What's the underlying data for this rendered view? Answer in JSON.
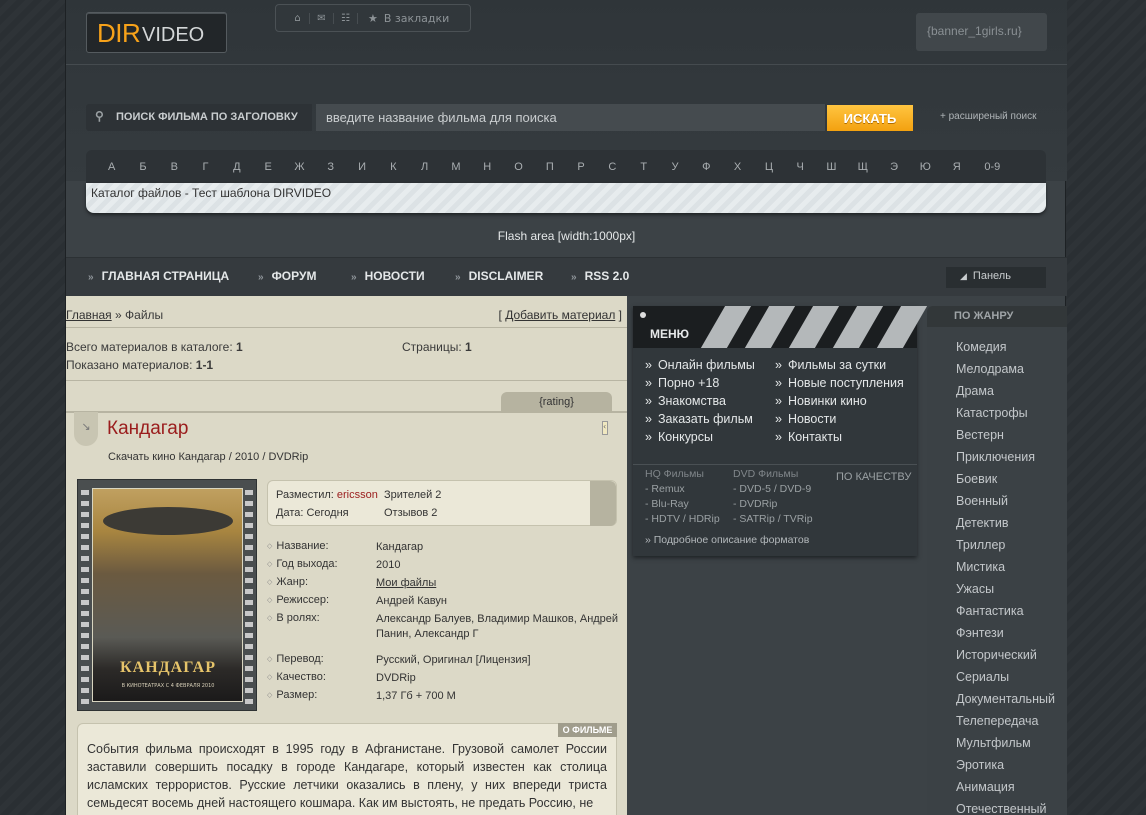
{
  "logo": {
    "part1": "DIR",
    "part2": "VIDEO"
  },
  "topnav": {
    "icons": [
      "home-icon",
      "mail-icon",
      "sitemap-icon"
    ],
    "bookmark": "В закладки"
  },
  "banner": "{banner_1girls.ru}",
  "search": {
    "label": "ПОИСК ФИЛЬМА ПО ЗАГОЛОВКУ",
    "placeholder": "введите название фильма для поиска",
    "button": "ИСКАТЬ",
    "advanced": "+ расширеный поиск"
  },
  "alphabet": [
    "А",
    "Б",
    "В",
    "Г",
    "Д",
    "Е",
    "Ж",
    "З",
    "И",
    "К",
    "Л",
    "М",
    "Н",
    "О",
    "П",
    "Р",
    "С",
    "Т",
    "У",
    "Ф",
    "Х",
    "Ц",
    "Ч",
    "Ш",
    "Щ",
    "Э",
    "Ю",
    "Я",
    "0-9"
  ],
  "breadcrumb_bar": "Каталог файлов - Тест шаблона DIRVIDEO",
  "flash": "Flash area [width:1000px]",
  "mainnav": {
    "items": [
      "ГЛАВНАЯ СТРАНИЦА",
      "ФОРУМ",
      "НОВОСТИ",
      "DISCLAIMER",
      "RSS 2.0"
    ],
    "panel": "Панель"
  },
  "content": {
    "breadcrumb": {
      "home": "Главная",
      "sep": " » ",
      "current": "Файлы"
    },
    "add": {
      "open": "[ ",
      "label": "Добавить материал",
      "close": " ]"
    },
    "total_label": "Всего материалов в каталоге: ",
    "total": "1",
    "shown_label": "Показано материалов: ",
    "shown": "1-1",
    "pages_label": "Страницы: ",
    "pages": "1",
    "rating_tab": "{rating}",
    "movie_title": "Кандагар",
    "subtitle": "Скачать кино Кандагар / 2010 / DVDRip",
    "poster": {
      "title": "КАНДАГАР",
      "date": "В КИНОТЕАТРАХ С 4 ФЕВРАЛЯ 2010"
    },
    "info": {
      "posted_label": "Разместил: ",
      "posted_by": "ericsson",
      "viewers": "Зрителей 2",
      "date": "Дата: Сегодня",
      "reviews": "Отзывов 2"
    },
    "details": [
      {
        "k": "Название:",
        "v": "Кандагар"
      },
      {
        "k": "Год выхода:",
        "v": "2010"
      },
      {
        "k": "Жанр:",
        "v": "Мои файлы"
      },
      {
        "k": "Режиссер:",
        "v": "Андрей Кавун"
      },
      {
        "k": "В ролях:",
        "v": "Александр Балуев, Владимир Машков, Андрей Панин, Александр Г"
      },
      {
        "k": "Перевод:",
        "v": "Русский, Оригинал [Лицензия]"
      },
      {
        "k": "Качество:",
        "v": "DVDRip"
      },
      {
        "k": "Размер:",
        "v": "1,37 Гб + 700 М"
      }
    ],
    "about_header": "О ФИЛЬМЕ",
    "about_text": "События фильма происходят в 1995 году в Афганистане. Грузовой самолет России заставили совершить посадку в городе Кандагаре, который известен как столица исламских террористов. Русские летчики оказались в плену, у них впереди триста семьдесят восемь дней настоящего кошмара. Как им выстоять, не предать Россию, не"
  },
  "menu": {
    "title": "МЕНЮ",
    "col1": [
      "Онлайн фильмы",
      "Порно +18",
      "Знакомства",
      "Заказать фильм",
      "Конкурсы"
    ],
    "col2": [
      "Фильмы за сутки",
      "Новые поступления",
      "Новинки кино",
      "Новости",
      "Контакты"
    ],
    "quality_title": "ПО КАЧЕСТВУ",
    "hq_title": "HQ Фильмы",
    "hq": [
      "- Remux",
      "- Blu-Ray",
      "- HDTV / HDRip"
    ],
    "dvd_title": "DVD Фильмы",
    "dvd": [
      "- DVD-5 / DVD-9",
      "- DVDRip",
      "- SATRip / TVRip"
    ],
    "formats": "» Подробное описание форматов"
  },
  "genres": {
    "title": "ПО ЖАНРУ",
    "items": [
      "Комедия",
      "Мелодрама",
      "Драма",
      "Катастрофы",
      "Вестерн",
      "Приключения",
      "Боевик",
      "Военный",
      "Детектив",
      "Триллер",
      "Мистика",
      "Ужасы",
      "Фантастика",
      "Фэнтези",
      "Исторический",
      "Сериалы",
      "Документальный",
      "Телепередача",
      "Мультфильм",
      "Эротика",
      "Анимация",
      "Отечественный"
    ]
  },
  "colors": {
    "accent": "#f7a21a",
    "button": "#f3a10f",
    "title_red": "#9a1c1c",
    "content_bg": "#dcd9c7"
  }
}
